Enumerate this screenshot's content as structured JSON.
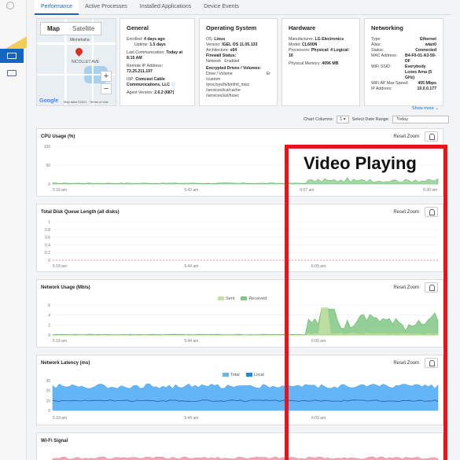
{
  "tabs": [
    {
      "label": "Performance",
      "active": true
    },
    {
      "label": "Active Processes",
      "active": false
    },
    {
      "label": "Installed Applications",
      "active": false
    },
    {
      "label": "Device Events",
      "active": false
    }
  ],
  "map": {
    "tab_map": "Map",
    "tab_satellite": "Satellite",
    "city_label": "Minnehaha",
    "area_label": "NICOLLET AVE",
    "zoom_in": "+",
    "zoom_out": "−",
    "logo": "Google",
    "footer": "Map data ©2021 · Terms of Use"
  },
  "general": {
    "title": "General",
    "enrolled_label": "Enrolled:",
    "enrolled_value": "4 days ago",
    "uptime_label": "Uptime:",
    "uptime_value": "1.5 days",
    "last_comm_label": "Last Communication:",
    "last_comm_value": "Today at 8:15 AM",
    "remote_ip_label": "Remote IP Address:",
    "remote_ip_value": "73.25.211.197",
    "isp_label": "ISP:",
    "isp_value": "Comcast Cable Communications, LLC",
    "agent_label": "Agent Version:",
    "agent_value": "2.6.2 (687)"
  },
  "os": {
    "title": "Operating System",
    "os_label": "OS:",
    "os_value": "Linux",
    "version_label": "Version:",
    "version_value": "IGEL OS 11.05.133",
    "arch_label": "Architecture:",
    "arch_value": "x64",
    "firewall_label": "Firewall Status:",
    "firewall_net": "Network",
    "firewall_value": "Enabled",
    "enc_label": "Encrypted Drives / Volumes:",
    "enc_header": "Drive / Volume",
    "enc_rows": [
      "/custom",
      "/proc/sys/fs/binfmt_misc",
      "/services/ica/cache",
      "/services/ssl/fusec"
    ],
    "enc_status": "Er"
  },
  "hardware": {
    "title": "Hardware",
    "mfr_label": "Manufacturer:",
    "mfr_value": "LG Electronics",
    "model_label": "Model:",
    "model_value": "CL600N",
    "proc_label": "Processors:",
    "proc_value": "Physical: 4 Logical: 16",
    "mem_label": "Physical Memory:",
    "mem_value": "4096 MB"
  },
  "networking": {
    "title": "Networking",
    "rows": [
      {
        "label": "Type:",
        "value": "Ethernet"
      },
      {
        "label": "Alias:",
        "value": "wlan0"
      },
      {
        "label": "Status:",
        "value": "Connected"
      },
      {
        "label": "MAC Address:",
        "value": "B4-F0-01-A3-59-DF"
      },
      {
        "label": "WiFi SSID:",
        "value": "Everybody Loves Arna (5 GHz)"
      },
      {
        "label": "WiFi AP Max Speed:",
        "value": "405 Mbps"
      },
      {
        "label": "IP Address:",
        "value": "10.0.0.177"
      }
    ]
  },
  "show_more": "Show more ⌄",
  "controls": {
    "columns_label": "Chart Columns:",
    "columns_value": "1",
    "range_label": "Select Date Range:",
    "range_value": "Today"
  },
  "reset_zoom": "Reset Zoom",
  "charts": [
    {
      "title": "CPU Usage (%)",
      "yticks": [
        "100",
        "50",
        "0"
      ],
      "xticks": [
        "5:16 am",
        "5:43 am",
        "6:07 am",
        "6:30 am"
      ]
    },
    {
      "title": "Total Disk Queue Length (all disks)",
      "yticks": [
        "1",
        "0.8",
        "0.6",
        "0.4",
        "0.2",
        "0"
      ],
      "xticks": [
        "5:19 am",
        "5:44 am",
        "6:09 am"
      ]
    },
    {
      "title": "Network Usage (Mb/s)",
      "yticks": [
        "6",
        "4",
        "2",
        "0"
      ],
      "xticks": [
        "5:19 am",
        "5:44 am",
        "6:09 am"
      ],
      "legend": [
        "Sent",
        "Received"
      ]
    },
    {
      "title": "Network Latency (ms)",
      "yticks": [
        "30",
        "20",
        "10",
        "0"
      ],
      "xticks": [
        "5:19 am",
        "5:44 am",
        "6:09 am"
      ],
      "legend": [
        "Total",
        "Local"
      ]
    },
    {
      "title": "Wi-Fi Signal",
      "yticks": [],
      "xticks": []
    }
  ],
  "colors": {
    "accent": "#1565c0",
    "green": "#66bb6a",
    "green_light": "#a5d6a7",
    "blue": "#42a5f5",
    "blue_dark": "#1e5aa8",
    "red_dash": "#e57373",
    "pink": "#f4a6b5",
    "annotation": "#e8141c"
  },
  "annotation": {
    "label": "Video Playing"
  }
}
